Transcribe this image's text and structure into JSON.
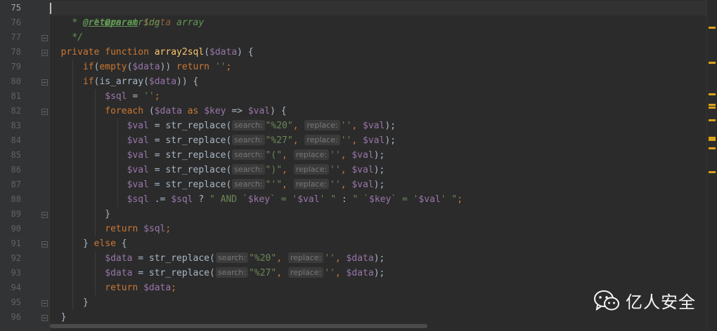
{
  "line_numbers": [
    "75",
    "76",
    "77",
    "78",
    "79",
    "80",
    "81",
    "82",
    "83",
    "84",
    "85",
    "86",
    "87",
    "88",
    "89",
    "90",
    "91",
    "92",
    "93",
    "94",
    "95",
    "96"
  ],
  "code": {
    "l75": {
      "star": "* ",
      "tag": "@param",
      "sp": " ",
      "type": "$data",
      "rest": " array"
    },
    "l76": {
      "star": "* ",
      "tag": "@return",
      "rest": " string"
    },
    "l77": {
      "text": "*/"
    },
    "l78": {
      "kw1": "private",
      "sp1": " ",
      "kw2": "function",
      "sp2": " ",
      "fn": "array2sql",
      "p1": "(",
      "v1": "$data",
      "p2": ") {"
    },
    "l79": {
      "kw1": "if",
      "p1": "(",
      "fn": "empty",
      "p2": "(",
      "v1": "$data",
      "p3": ")) ",
      "kw2": "return",
      "sp": " ",
      "str": "''",
      "p4": ";"
    },
    "l80": {
      "kw1": "if",
      "p1": "(",
      "fn": "is_array",
      "p2": "(",
      "v1": "$data",
      "p3": ")) {"
    },
    "l81": {
      "v1": "$sql",
      "p1": " = ",
      "str": "''",
      "p2": ";"
    },
    "l82": {
      "kw1": "foreach",
      "p1": " (",
      "v1": "$data",
      "sp1": " ",
      "kw2": "as",
      "sp2": " ",
      "v2": "$key",
      "p2": " => ",
      "v3": "$val",
      "p3": ") {"
    },
    "l83": {
      "v1": "$val",
      "p1": " = ",
      "fn": "str_replace",
      "p2": "(",
      "hint1": "search:",
      "s1": "\"%20\"",
      "p3": ", ",
      "hint2": "replace:",
      "s2": "''",
      "p4": ", ",
      "v2": "$val",
      "p5": ");"
    },
    "l84": {
      "v1": "$val",
      "p1": " = ",
      "fn": "str_replace",
      "p2": "(",
      "hint1": "search:",
      "s1": "\"%27\"",
      "p3": ", ",
      "hint2": "replace:",
      "s2": "''",
      "p4": ", ",
      "v2": "$val",
      "p5": ");"
    },
    "l85": {
      "v1": "$val",
      "p1": " = ",
      "fn": "str_replace",
      "p2": "(",
      "hint1": "search:",
      "s1": "\"(\"",
      "p3": ", ",
      "hint2": "replace:",
      "s2": "''",
      "p4": ", ",
      "v2": "$val",
      "p5": ");"
    },
    "l86": {
      "v1": "$val",
      "p1": " = ",
      "fn": "str_replace",
      "p2": "(",
      "hint1": "search:",
      "s1": "\")\"",
      "p3": ", ",
      "hint2": "replace:",
      "s2": "''",
      "p4": ", ",
      "v2": "$val",
      "p5": ");"
    },
    "l87": {
      "v1": "$val",
      "p1": " = ",
      "fn": "str_replace",
      "p2": "(",
      "hint1": "search:",
      "s1": "\"'\"",
      "p3": ", ",
      "hint2": "replace:",
      "s2": "''",
      "p4": ", ",
      "v2": "$val",
      "p5": ");"
    },
    "l88": {
      "v1": "$sql",
      "p1": " .= ",
      "v2": "$sql",
      "p2": " ? ",
      "s1": "\" AND `",
      "v3": "$key",
      "s2": "` = '",
      "v4": "$val",
      "s3": "' \"",
      "p3": " : ",
      "s4": "\" `",
      "v5": "$key",
      "s5": "` = '",
      "v6": "$val",
      "s6": "' \"",
      "p4": ";"
    },
    "l89": {
      "text": "}"
    },
    "l90": {
      "kw": "return",
      "sp": " ",
      "v1": "$sql",
      "p1": ";"
    },
    "l91": {
      "p1": "} ",
      "kw": "else",
      "p2": " {"
    },
    "l92": {
      "v1": "$data",
      "p1": " = ",
      "fn": "str_replace",
      "p2": "(",
      "hint1": "search:",
      "s1": "\"%20\"",
      "p3": ", ",
      "hint2": "replace:",
      "s2": "''",
      "p4": ", ",
      "v2": "$data",
      "p5": ");"
    },
    "l93": {
      "v1": "$data",
      "p1": " = ",
      "fn": "str_replace",
      "p2": "(",
      "hint1": "search:",
      "s1": "\"%27\"",
      "p3": ", ",
      "hint2": "replace:",
      "s2": "''",
      "p4": ", ",
      "v2": "$data",
      "p5": ");"
    },
    "l94": {
      "kw": "return",
      "sp": " ",
      "v1": "$data",
      "p1": ";"
    },
    "l95": {
      "text": "}"
    },
    "l96": {
      "text": "}"
    }
  },
  "watermark": {
    "text": "亿人安全",
    "icon": "wechat-icon"
  },
  "colors": {
    "background": "#2b2b2b",
    "gutter": "#313335",
    "keyword": "#cc7832",
    "function": "#ffc66d",
    "variable": "#9876aa",
    "string": "#6a8759",
    "doc_comment": "#629755",
    "marker": "#d9a21b"
  }
}
